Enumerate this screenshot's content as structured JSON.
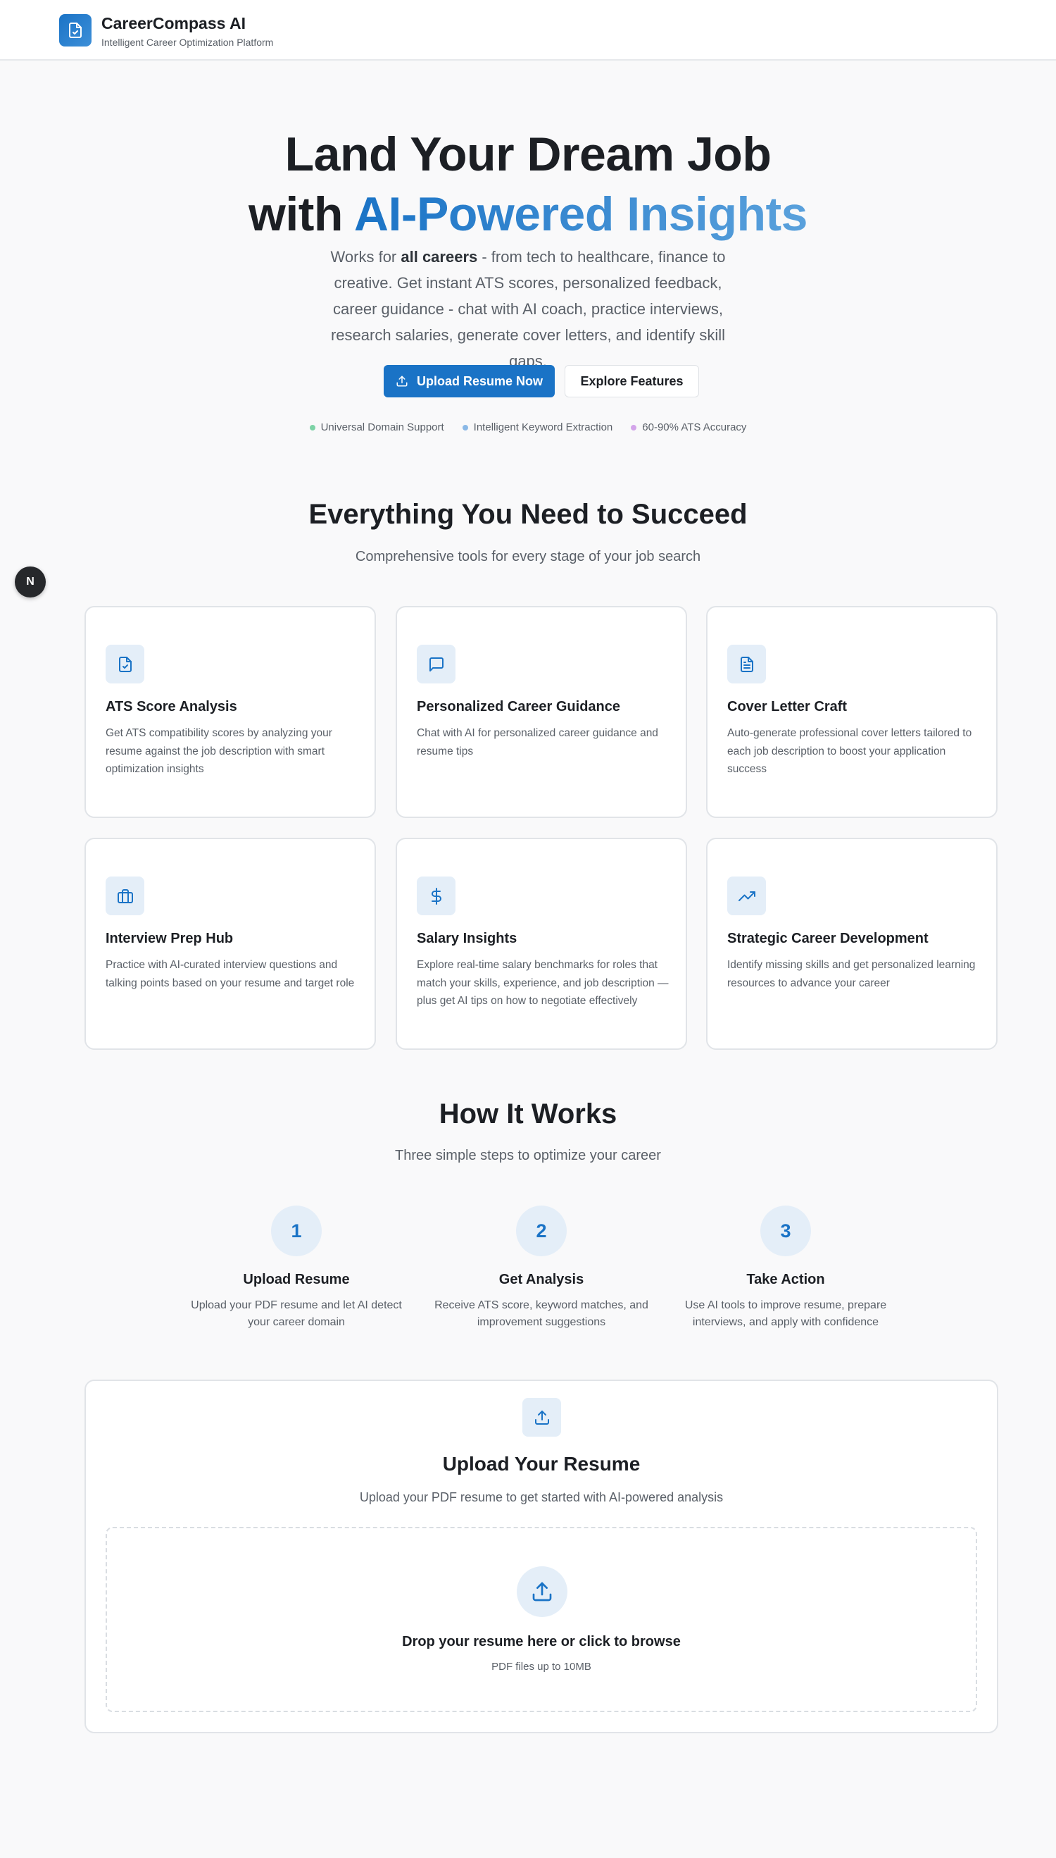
{
  "header": {
    "brand_title": "CareerCompass AI",
    "brand_subtitle": "Intelligent Career Optimization Platform",
    "logo_icon": "file-check-icon"
  },
  "hero": {
    "title_line1": "Land Your Dream Job",
    "title_line2_prefix": "with ",
    "title_line2_highlight": "AI-Powered Insights",
    "desc_prefix": "Works for ",
    "desc_bold": "all careers",
    "desc_rest": " - from tech to healthcare, finance to creative. Get instant ATS scores, personalized feedback, career guidance - chat with AI coach, practice interviews, research salaries, generate cover letters, and identify skill gaps.",
    "primary_button": "Upload Resume Now",
    "secondary_button": "Explore Features",
    "badges": [
      {
        "label": "Universal Domain Support",
        "color": "#7dd3a6"
      },
      {
        "label": "Intelligent Keyword Extraction",
        "color": "#8ab8e6"
      },
      {
        "label": "60-90% ATS Accuracy",
        "color": "#d3a4ea"
      }
    ]
  },
  "floating_badge": "N",
  "features": {
    "title": "Everything You Need to Succeed",
    "subtitle": "Comprehensive tools for every stage of your job search",
    "cards": [
      {
        "icon": "file-check-icon",
        "title": "ATS Score Analysis",
        "desc": "Get ATS compatibility scores by analyzing your resume against the job description with smart optimization insights"
      },
      {
        "icon": "message-square-icon",
        "title": "Personalized Career Guidance",
        "desc": "Chat with AI for personalized career guidance and resume tips"
      },
      {
        "icon": "file-text-icon",
        "title": "Cover Letter Craft",
        "desc": "Auto-generate professional cover letters tailored to each job description to boost your application success"
      },
      {
        "icon": "briefcase-icon",
        "title": "Interview Prep Hub",
        "desc": "Practice with AI-curated interview questions and talking points based on your resume and target role"
      },
      {
        "icon": "dollar-sign-icon",
        "title": "Salary Insights",
        "desc": "Explore real-time salary benchmarks for roles that match your skills, experience, and job description — plus get AI tips on how to negotiate effectively"
      },
      {
        "icon": "trending-up-icon",
        "title": "Strategic Career Development",
        "desc": "Identify missing skills and get personalized learning resources to advance your career"
      }
    ]
  },
  "how": {
    "title": "How It Works",
    "subtitle": "Three simple steps to optimize your career",
    "steps": [
      {
        "num": "1",
        "title": "Upload Resume",
        "desc": "Upload your PDF resume and let AI detect your career domain"
      },
      {
        "num": "2",
        "title": "Get Analysis",
        "desc": "Receive ATS score, keyword matches, and improvement suggestions"
      },
      {
        "num": "3",
        "title": "Take Action",
        "desc": "Use AI tools to improve resume, prepare interviews, and apply with confidence"
      }
    ]
  },
  "upload": {
    "title": "Upload Your Resume",
    "subtitle": "Upload your PDF resume to get started with AI-powered analysis",
    "drop_title": "Drop your resume here or click to browse",
    "drop_sub": "PDF files up to 10MB"
  },
  "colors": {
    "accent": "#1a73c6",
    "icon_bg": "#e4eef8",
    "page_bg": "#f9f9fa"
  }
}
